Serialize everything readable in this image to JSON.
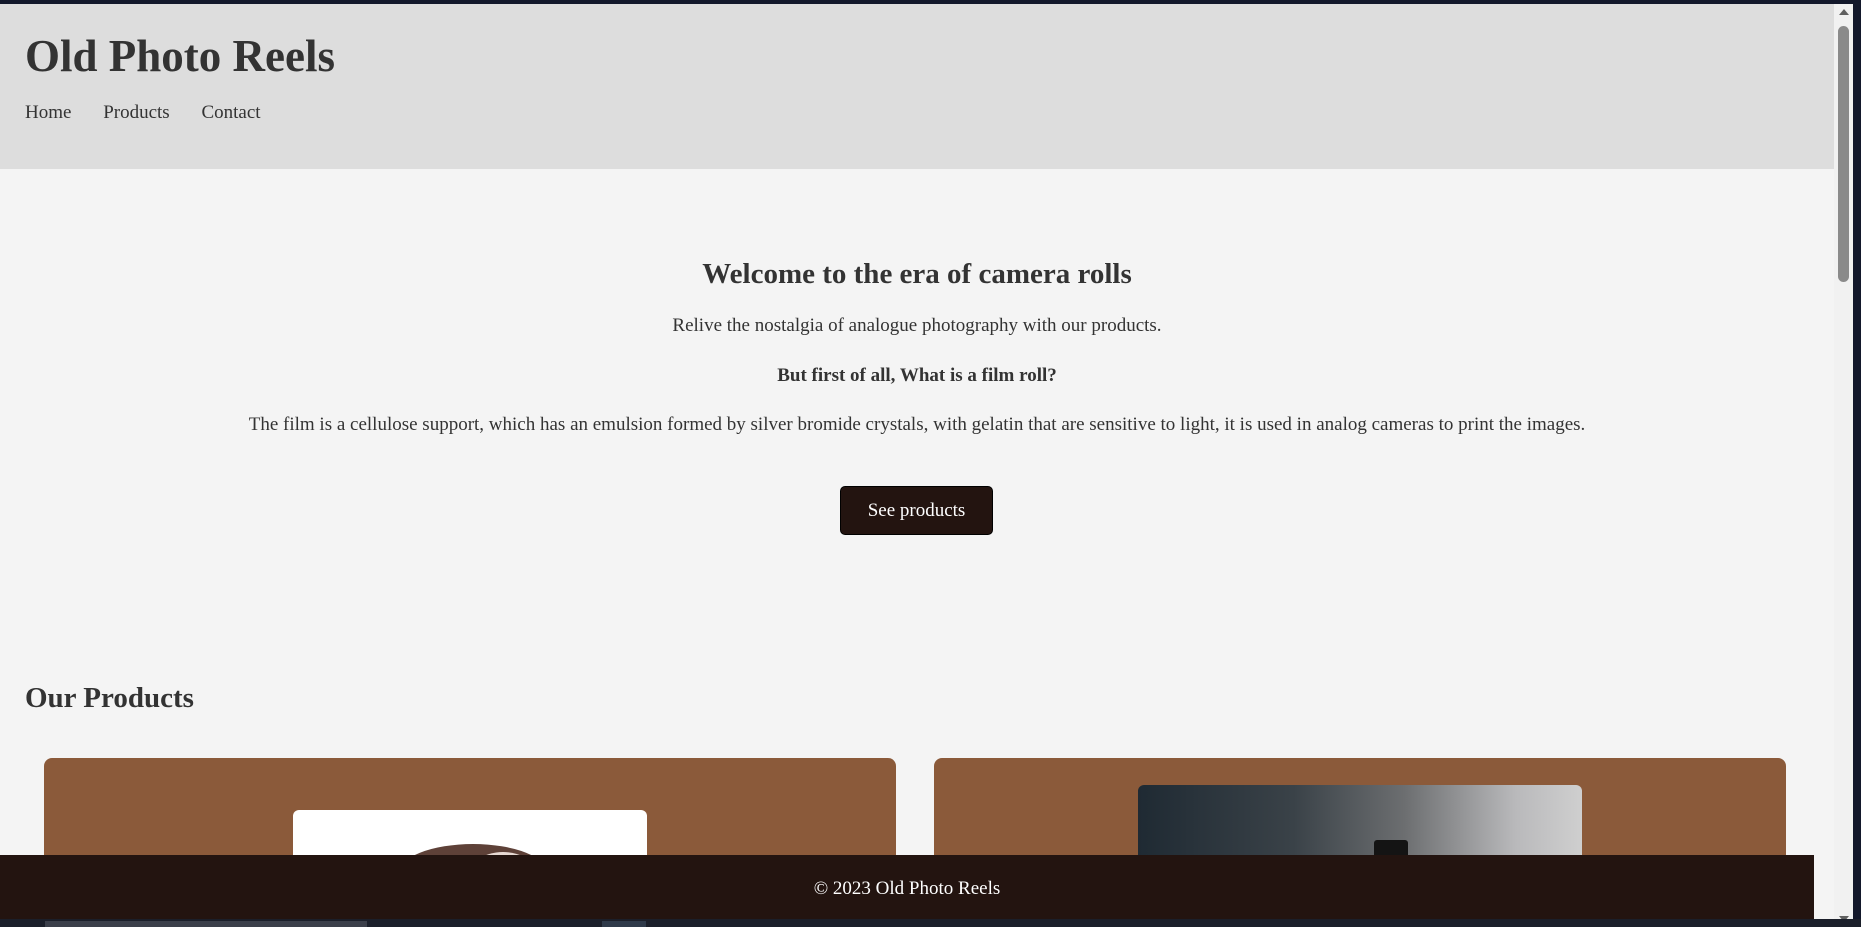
{
  "site": {
    "title": "Old Photo Reels",
    "nav": [
      "Home",
      "Products",
      "Contact"
    ]
  },
  "hero": {
    "heading": "Welcome to the era of camera rolls",
    "subtitle": "Relive the nostalgia of analogue photography with our products.",
    "question": "But first of all, What is a film roll?",
    "description": "The film is a cellulose support, which has an emulsion formed by silver bromide crystals, with gelatin that are sensitive to light, it is used in analog cameras to print the images.",
    "cta_label": "See products"
  },
  "products": {
    "title": "Our Products",
    "cards": [
      {
        "image_icon": "film-reel-photo"
      },
      {
        "image_icon": "film-canister-photo"
      }
    ]
  },
  "footer": {
    "copyright": "© 2023 Old Photo Reels"
  },
  "colors": {
    "header_bg": "#dddddd",
    "page_bg": "#f4f4f4",
    "card_bg": "#8b5a3a",
    "button_bg": "#231410",
    "footer_bg": "#231410",
    "text": "#333333"
  }
}
